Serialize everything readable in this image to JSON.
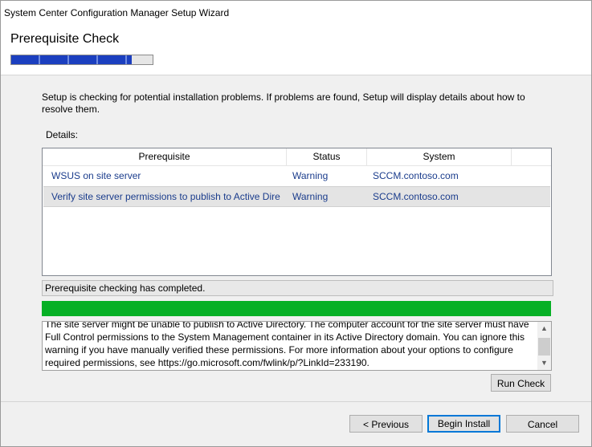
{
  "window": {
    "title": "System Center Configuration Manager Setup Wizard"
  },
  "header": {
    "page_title": "Prerequisite Check",
    "progress_percent": 85
  },
  "intro_text": "Setup is checking for potential installation problems. If problems are found, Setup will display details about how to resolve them.",
  "details_label": "Details:",
  "grid": {
    "columns": [
      "Prerequisite",
      "Status",
      "System"
    ],
    "rows": [
      {
        "prerequisite": "WSUS on site server",
        "status": "Warning",
        "system": "SCCM.contoso.com"
      },
      {
        "prerequisite": "Verify site server permissions to publish to Active Dire",
        "status": "Warning",
        "system": "SCCM.contoso.com"
      }
    ]
  },
  "status_message": "Prerequisite checking has completed.",
  "description": "The site server might be unable to publish to Active Directory. The computer account for the site server must have Full Control permissions to the System Management container in its Active Directory domain. You can ignore this warning if you have manually verified these permissions. For more information about your options to configure required permissions, see https://go.microsoft.com/fwlink/p/?LinkId=233190.",
  "buttons": {
    "run_check": "Run Check",
    "previous": "< Previous",
    "begin_install": "Begin Install",
    "cancel": "Cancel"
  },
  "colors": {
    "progress_green": "#06b025",
    "progress_blue": "#1b3fbf",
    "link_text": "#1a3c8c"
  }
}
